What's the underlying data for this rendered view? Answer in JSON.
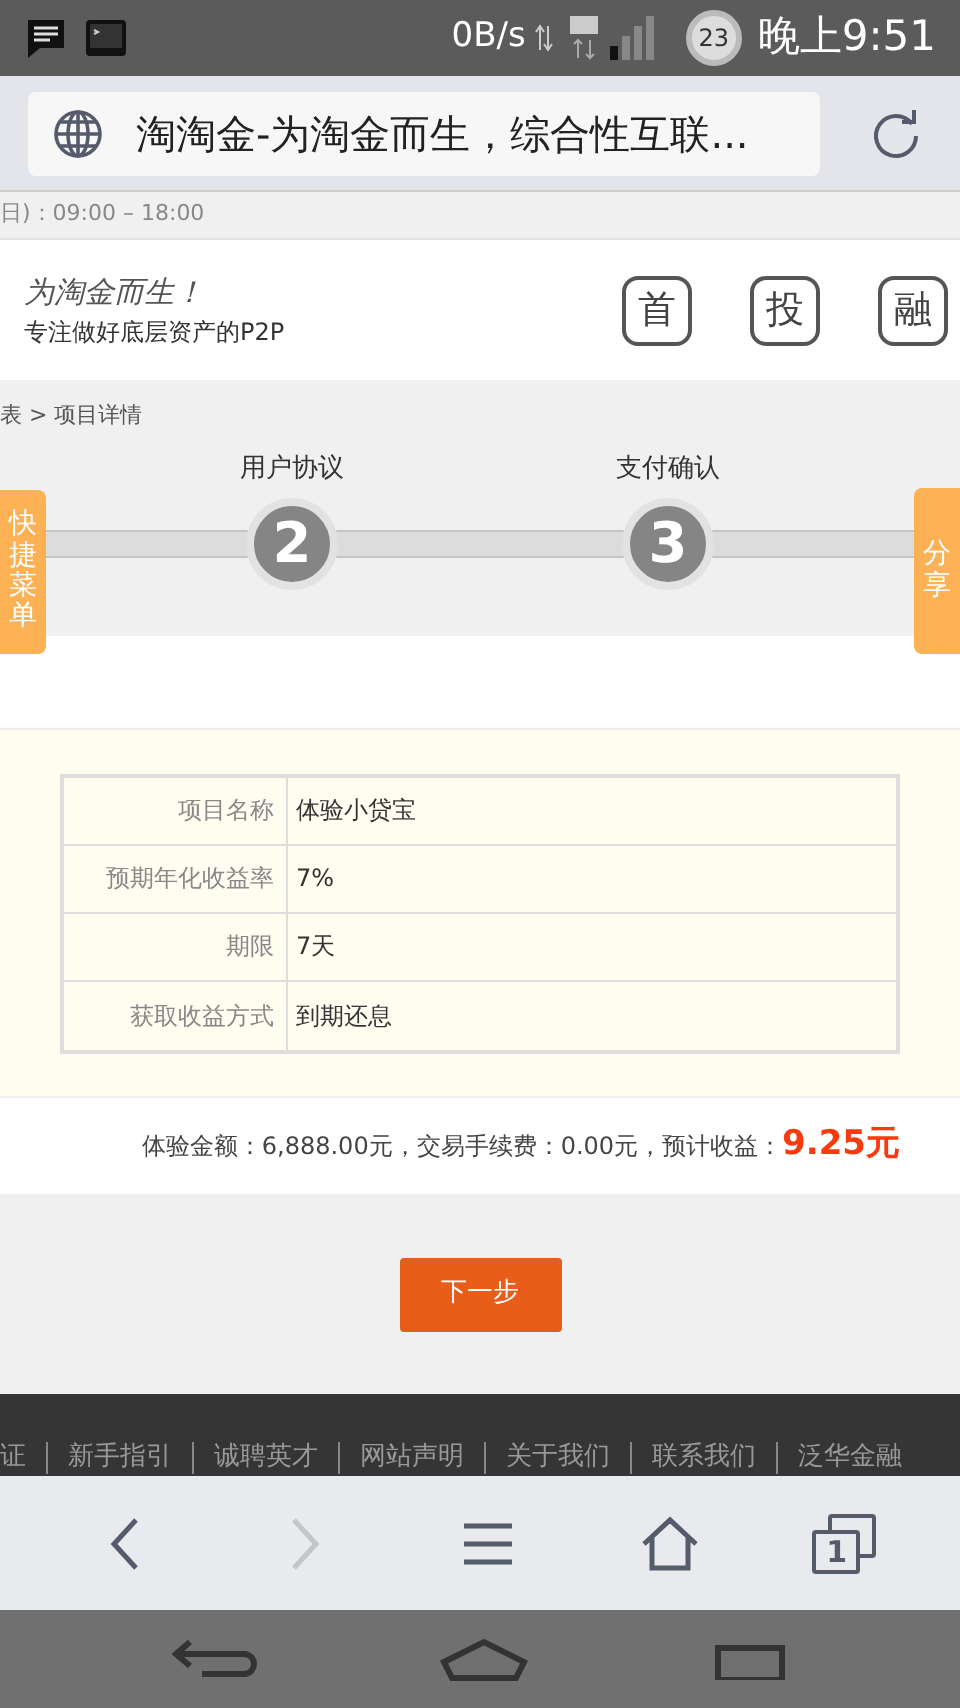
{
  "status_bar": {
    "speed": "0B/s",
    "battery": "23",
    "time": "晚上9:51"
  },
  "address_bar": {
    "title": "淘淘金-为淘金而生，综合性互联..."
  },
  "hours_bar": {
    "text": "日)：09:00 – 18:00"
  },
  "header": {
    "slogan": "为淘金而生！",
    "tagline": "专注做好底层资产的P2P",
    "nav": [
      "首",
      "投",
      "融"
    ]
  },
  "breadcrumb": "表 > 项目详情",
  "steps": [
    {
      "number": "2",
      "label": "用户协议"
    },
    {
      "number": "3",
      "label": "支付确认"
    }
  ],
  "side_tabs": {
    "left": "快捷菜单",
    "right": "分享"
  },
  "details": [
    {
      "label": "项目名称",
      "value": "体验小贷宝"
    },
    {
      "label": "预期年化收益率",
      "value": "7%"
    },
    {
      "label": "期限",
      "value": "7天"
    },
    {
      "label": "获取收益方式",
      "value": "到期还息"
    }
  ],
  "summary": {
    "text": "体验金额：6,888.00元，交易手续费：0.00元，预计收益：",
    "amount": "9.25元"
  },
  "next_button": "下一步",
  "footer_links": [
    "证",
    "新手指引",
    "诚聘英才",
    "网站声明",
    "关于我们",
    "联系我们",
    "泛华金融"
  ],
  "browser_toolbar": {
    "tab_count": "1"
  }
}
